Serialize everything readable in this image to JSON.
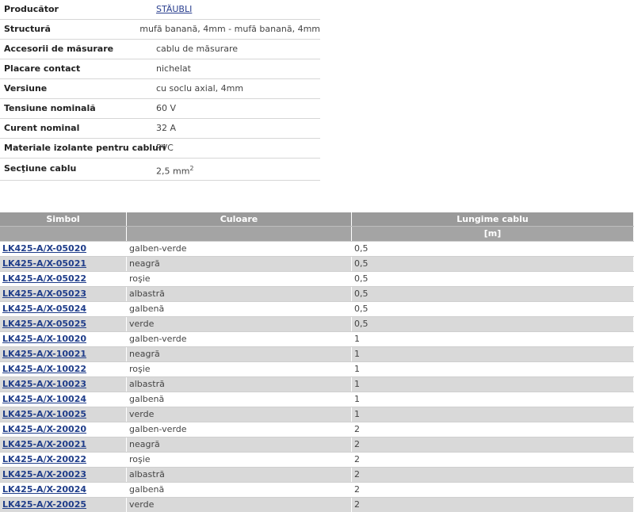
{
  "specs": [
    {
      "label": "Producător",
      "value": "STÄUBLI",
      "link": true
    },
    {
      "label": "Structură",
      "value": "mufă banană, 4mm - mufă banană, 4mm"
    },
    {
      "label": "Accesorii de măsurare",
      "value": "cablu de măsurare"
    },
    {
      "label": "Placare contact",
      "value": "nichelat"
    },
    {
      "label": "Versiune",
      "value": "cu soclu axial, 4mm"
    },
    {
      "label": "Tensiune nominală",
      "value": "60 V"
    },
    {
      "label": "Curent nominal",
      "value": "32 A"
    },
    {
      "label": "Materiale izolante pentru cabluri",
      "value": "PVC"
    },
    {
      "label": "Secţiune cablu",
      "value": "2,5 mm",
      "sup": "2"
    }
  ],
  "table": {
    "headers": [
      "Simbol",
      "Culoare",
      "Lungime cablu"
    ],
    "unit_row": [
      "",
      "",
      "[m]"
    ],
    "rows": [
      {
        "symbol": "LK425-A/X-05020",
        "color": "galben-verde",
        "length": "0,5"
      },
      {
        "symbol": "LK425-A/X-05021",
        "color": "neagră",
        "length": "0,5"
      },
      {
        "symbol": "LK425-A/X-05022",
        "color": "roşie",
        "length": "0,5"
      },
      {
        "symbol": "LK425-A/X-05023",
        "color": "albastră",
        "length": "0,5"
      },
      {
        "symbol": "LK425-A/X-05024",
        "color": "galbenă",
        "length": "0,5"
      },
      {
        "symbol": "LK425-A/X-05025",
        "color": "verde",
        "length": "0,5"
      },
      {
        "symbol": "LK425-A/X-10020",
        "color": "galben-verde",
        "length": "1"
      },
      {
        "symbol": "LK425-A/X-10021",
        "color": "neagră",
        "length": "1"
      },
      {
        "symbol": "LK425-A/X-10022",
        "color": "roşie",
        "length": "1"
      },
      {
        "symbol": "LK425-A/X-10023",
        "color": "albastră",
        "length": "1"
      },
      {
        "symbol": "LK425-A/X-10024",
        "color": "galbenă",
        "length": "1"
      },
      {
        "symbol": "LK425-A/X-10025",
        "color": "verde",
        "length": "1"
      },
      {
        "symbol": "LK425-A/X-20020",
        "color": "galben-verde",
        "length": "2"
      },
      {
        "symbol": "LK425-A/X-20021",
        "color": "neagră",
        "length": "2"
      },
      {
        "symbol": "LK425-A/X-20022",
        "color": "roşie",
        "length": "2"
      },
      {
        "symbol": "LK425-A/X-20023",
        "color": "albastră",
        "length": "2"
      },
      {
        "symbol": "LK425-A/X-20024",
        "color": "galbenă",
        "length": "2"
      },
      {
        "symbol": "LK425-A/X-20025",
        "color": "verde",
        "length": "2"
      }
    ]
  }
}
